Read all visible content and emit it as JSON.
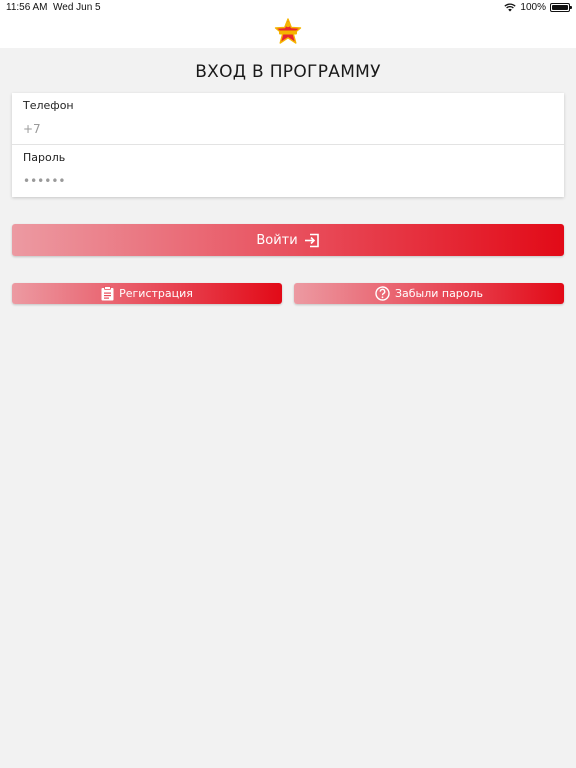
{
  "status_bar": {
    "time": "11:56 AM",
    "date": "Wed Jun 5",
    "battery": "100%"
  },
  "header": {
    "logo_icon": "star-logo-icon"
  },
  "page": {
    "title": "ВХОД В ПРОГРАММУ"
  },
  "form": {
    "phone_label": "Телефон",
    "phone_placeholder": "+7",
    "password_label": "Пароль",
    "password_placeholder": "••••••"
  },
  "buttons": {
    "login_label": "Войти",
    "login_icon": "sign-in-icon",
    "register_label": "Регистрация",
    "register_icon": "clipboard-icon",
    "forgot_label": "Забыли пароль",
    "forgot_icon": "question-circle-icon"
  },
  "colors": {
    "accent": "#e20a17",
    "accent_light": "#ec9aa2",
    "background": "#f2f2f2"
  }
}
